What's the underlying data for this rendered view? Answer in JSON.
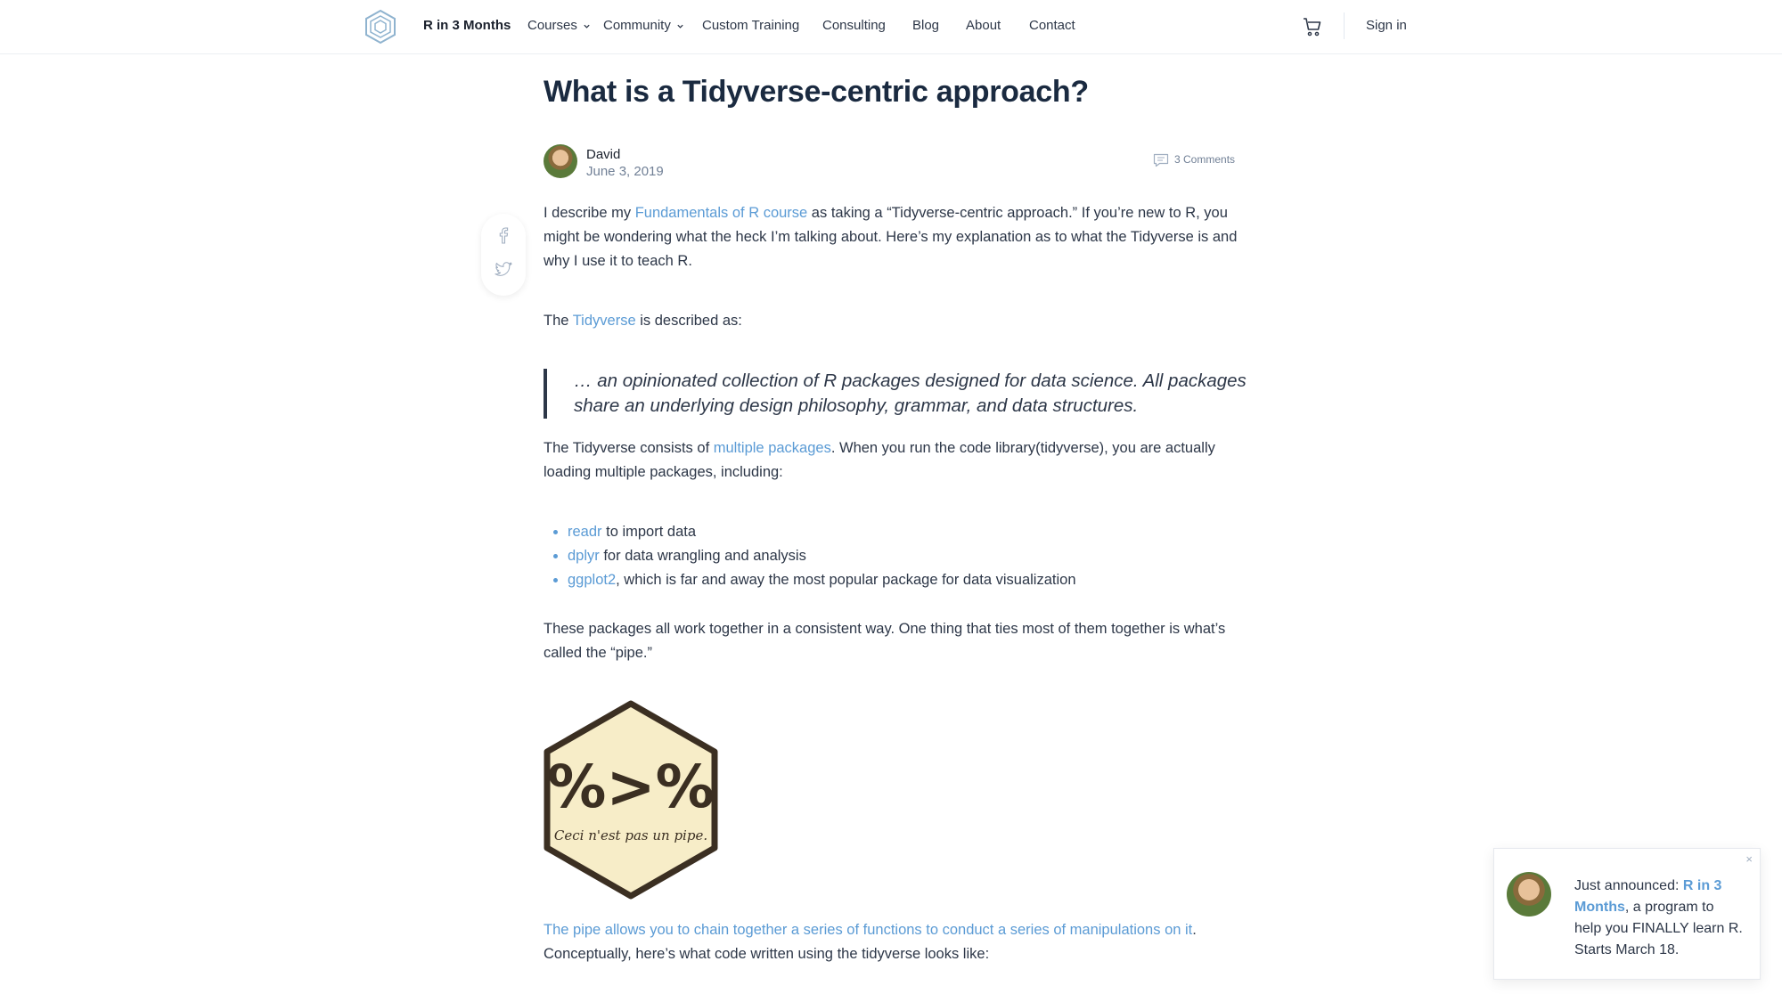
{
  "header": {
    "brand": "R in 3 Months",
    "nav": [
      "Courses",
      "Community",
      "Custom Training",
      "Consulting",
      "Blog",
      "About",
      "Contact"
    ],
    "sign_in": "Sign in",
    "icons": [
      "logo-icon",
      "chevron-down-icon",
      "cart-icon"
    ]
  },
  "article": {
    "title": "What is a Tidyverse-centric approach?",
    "author": "David",
    "date": "June 3, 2019",
    "comments": "3 Comments",
    "share_icons": [
      "facebook-icon",
      "twitter-icon"
    ],
    "p1": {
      "before": "I describe my ",
      "link": "Fundamentals of R course",
      "after": " as taking a “Tidyverse-centric approach.” If you’re new to R, you might be wondering what the heck I’m talking about. Here’s my explanation as to what the Tidyverse is and why I use it to teach R."
    },
    "p2": {
      "before": "The ",
      "link": "Tidyverse",
      "after": " is described as:"
    },
    "quote": "… an opinionated collection of R packages designed for data science. All packages share an underlying design philosophy, grammar, and data structures.",
    "p3": {
      "before": "The Tidyverse consists of ",
      "link": "multiple packages",
      "after": ". When you run the code library(tidyverse), you are actually loading multiple packages, including:"
    },
    "packages": [
      {
        "link": "readr",
        "text": " to import data"
      },
      {
        "link": "dplyr",
        "text": " for data wrangling and analysis"
      },
      {
        "link": "ggplot2",
        "text": ", which is far and away the most popular package for data visualization"
      }
    ],
    "p4": "These packages all work together in a consistent way. One thing that ties most of them together is what’s called the “pipe.”",
    "pipe_logo": {
      "symbol": "%>%",
      "caption": "Ceci n'est pas un pipe."
    },
    "p5": {
      "link": "The pipe allows you to chain together a series of functions to conduct a series of manipulations on it",
      "after": ". Conceptually, here’s what code written using the tidyverse looks like:"
    }
  },
  "popup": {
    "close": "×",
    "before": "Just announced: ",
    "link": "R in 3 Months",
    "after": ", a program to help you FINALLY learn R. Starts March 18."
  },
  "colors": {
    "link": "#5b9bd5",
    "text": "#2d3748",
    "title": "#1a2a40"
  }
}
